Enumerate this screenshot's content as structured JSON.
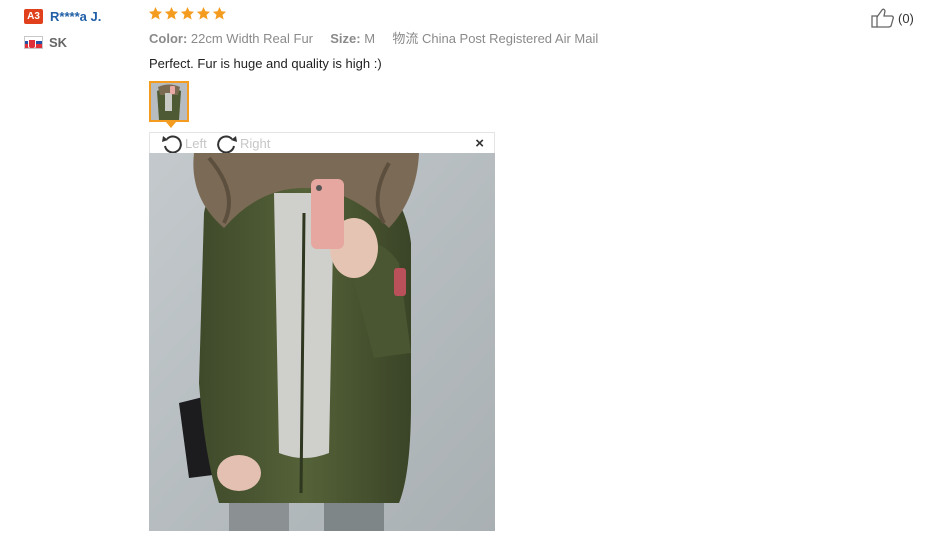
{
  "reviewer": {
    "level_badge": "A3",
    "name": "R****a J.",
    "country_code": "SK"
  },
  "review": {
    "rating": 5,
    "rating_max": 5,
    "star_color": "#f39c1f",
    "color_label": "Color:",
    "color_value": "22cm Width Real Fur",
    "size_label": "Size:",
    "size_value": "M",
    "shipping_label": "物流",
    "shipping_value": "China Post Registered Air Mail",
    "text": "Perfect. Fur is huge and quality is high :)"
  },
  "viewer": {
    "rotate_left_label": "Left",
    "rotate_right_label": "Right",
    "close_label": "×"
  },
  "like": {
    "count_text": "(0)"
  },
  "colors": {
    "name_link": "#1f5fa6",
    "badge": "#e0401c",
    "thumb_border": "#f39c1f"
  }
}
